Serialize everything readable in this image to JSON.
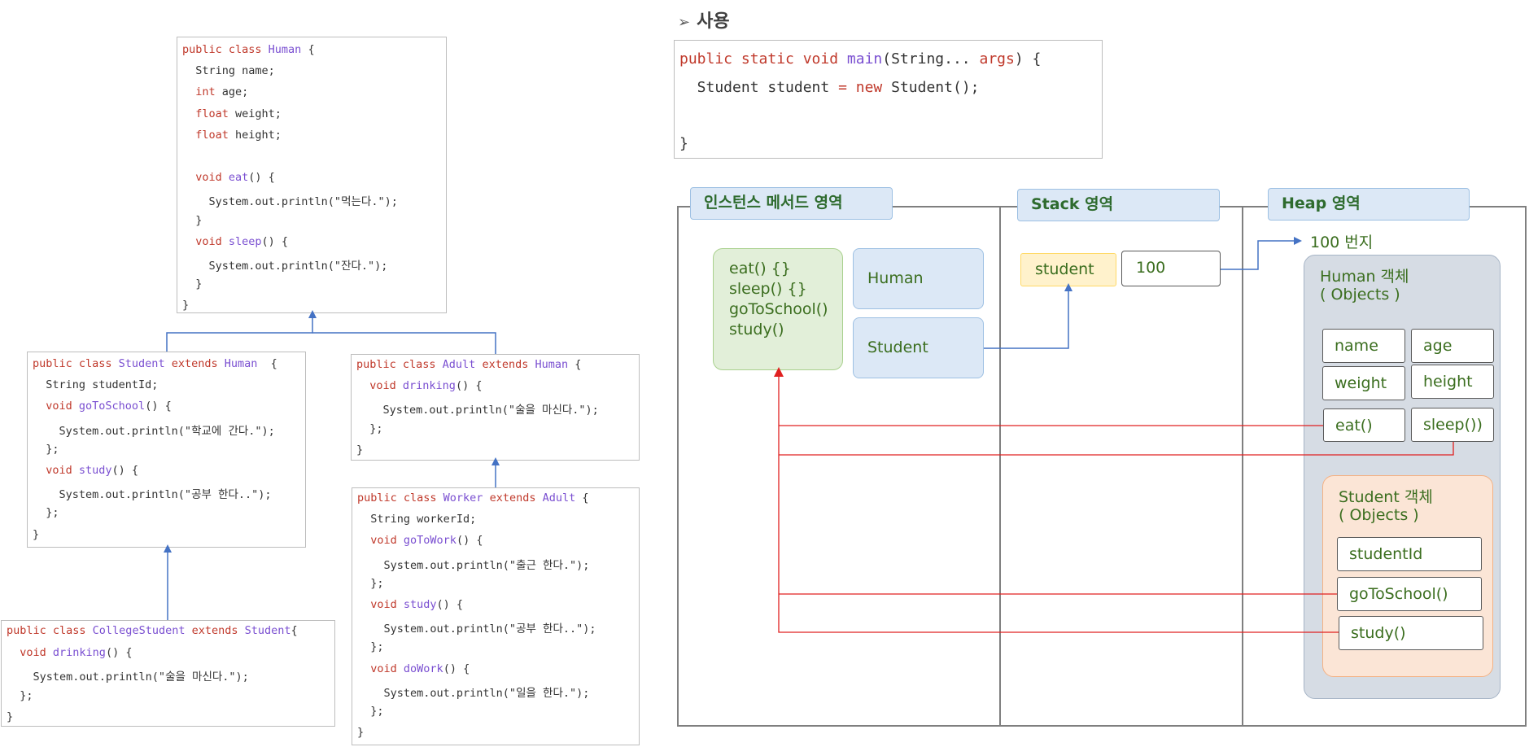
{
  "section_title": "사용",
  "classes": {
    "human": [
      [
        [
          "kw",
          "public class "
        ],
        [
          "tp",
          "Human"
        ],
        [
          "tx",
          " {"
        ]
      ],
      [
        [
          "tx",
          "  String name;"
        ]
      ],
      [
        [
          "kw",
          "  int"
        ],
        [
          "tx",
          " age;"
        ]
      ],
      [
        [
          "kw",
          "  float"
        ],
        [
          "tx",
          " weight;"
        ]
      ],
      [
        [
          "kw",
          "  float"
        ],
        [
          "tx",
          " height;"
        ]
      ],
      [
        [
          "tx",
          ""
        ]
      ],
      [
        [
          "kw",
          "  void "
        ],
        [
          "fn",
          "eat"
        ],
        [
          "tx",
          "() {"
        ]
      ],
      [
        [
          "tx",
          "    System.out.println(\"먹는다.\");"
        ]
      ],
      [
        [
          "tx",
          "  }"
        ]
      ],
      [
        [
          "kw",
          "  void "
        ],
        [
          "fn",
          "sleep"
        ],
        [
          "tx",
          "() {"
        ]
      ],
      [
        [
          "tx",
          "    System.out.println(\"잔다.\");"
        ]
      ],
      [
        [
          "tx",
          "  }"
        ]
      ],
      [
        [
          "tx",
          "}"
        ]
      ]
    ],
    "student": [
      [
        [
          "kw",
          "public class "
        ],
        [
          "tp",
          "Student"
        ],
        [
          "kw",
          " extends "
        ],
        [
          "tp",
          "Human"
        ],
        [
          "tx",
          "  {"
        ]
      ],
      [
        [
          "tx",
          "  String studentId;"
        ]
      ],
      [
        [
          "kw",
          "  void "
        ],
        [
          "fn",
          "goToSchool"
        ],
        [
          "tx",
          "() {"
        ]
      ],
      [
        [
          "tx",
          "    System.out.println(\"학교에 간다.\");"
        ]
      ],
      [
        [
          "tx",
          "  };"
        ]
      ],
      [
        [
          "kw",
          "  void "
        ],
        [
          "fn",
          "study"
        ],
        [
          "tx",
          "() {"
        ]
      ],
      [
        [
          "tx",
          "    System.out.println(\"공부 한다..\");"
        ]
      ],
      [
        [
          "tx",
          "  };"
        ]
      ],
      [
        [
          "tx",
          "}"
        ]
      ]
    ],
    "adult": [
      [
        [
          "kw",
          "public class "
        ],
        [
          "tp",
          "Adult"
        ],
        [
          "kw",
          " extends "
        ],
        [
          "tp",
          "Human"
        ],
        [
          "tx",
          " {"
        ]
      ],
      [
        [
          "kw",
          "  void "
        ],
        [
          "fn",
          "drinking"
        ],
        [
          "tx",
          "() {"
        ]
      ],
      [
        [
          "tx",
          "    System.out.println(\"술을 마신다.\");"
        ]
      ],
      [
        [
          "tx",
          "  };"
        ]
      ],
      [
        [
          "tx",
          "}"
        ]
      ]
    ],
    "college": [
      [
        [
          "kw",
          "public class "
        ],
        [
          "tp",
          "CollegeStudent"
        ],
        [
          "kw",
          " extends "
        ],
        [
          "tp",
          "Student"
        ],
        [
          "tx",
          "{"
        ]
      ],
      [
        [
          "kw",
          "  void "
        ],
        [
          "fn",
          "drinking"
        ],
        [
          "tx",
          "() {"
        ]
      ],
      [
        [
          "tx",
          "    System.out.println(\"술을 마신다.\");"
        ]
      ],
      [
        [
          "tx",
          "  };"
        ]
      ],
      [
        [
          "tx",
          "}"
        ]
      ]
    ],
    "worker": [
      [
        [
          "kw",
          "public class "
        ],
        [
          "tp",
          "Worker"
        ],
        [
          "kw",
          " extends "
        ],
        [
          "tp",
          "Adult"
        ],
        [
          "tx",
          " {"
        ]
      ],
      [
        [
          "tx",
          "  String workerId;"
        ]
      ],
      [
        [
          "kw",
          "  void "
        ],
        [
          "fn",
          "goToWork"
        ],
        [
          "tx",
          "() {"
        ]
      ],
      [
        [
          "tx",
          "    System.out.println(\"출근 한다.\");"
        ]
      ],
      [
        [
          "tx",
          "  };"
        ]
      ],
      [
        [
          "kw",
          "  void "
        ],
        [
          "fn",
          "study"
        ],
        [
          "tx",
          "() {"
        ]
      ],
      [
        [
          "tx",
          "    System.out.println(\"공부 한다..\");"
        ]
      ],
      [
        [
          "tx",
          "  };"
        ]
      ],
      [
        [
          "kw",
          "  void "
        ],
        [
          "fn",
          "doWork"
        ],
        [
          "tx",
          "() {"
        ]
      ],
      [
        [
          "tx",
          "    System.out.println(\"일을 한다.\");"
        ]
      ],
      [
        [
          "tx",
          "  };"
        ]
      ],
      [
        [
          "tx",
          "}"
        ]
      ]
    ],
    "main": [
      [
        [
          "kw",
          "public static void "
        ],
        [
          "fn",
          "main"
        ],
        [
          "tx",
          "(String... "
        ],
        [
          "kw",
          "args"
        ],
        [
          "tx",
          ") {"
        ]
      ],
      [
        [
          "tx",
          "  Student student "
        ],
        [
          "kw",
          "="
        ],
        [
          "kw",
          " new"
        ],
        [
          "tx",
          " Student();"
        ]
      ],
      [
        [
          "tx",
          ""
        ]
      ],
      [
        [
          "tx",
          "}"
        ]
      ]
    ]
  },
  "memory": {
    "method_area_title": "인스턴스 메서드 영역",
    "stack_title": "Stack 영역",
    "heap_title": "Heap 영역",
    "methods": [
      "eat() {}",
      "sleep() {}",
      "goToSchool()",
      "study()"
    ],
    "class_boxes": [
      "Human",
      "Student"
    ],
    "stack_var": "student",
    "stack_value": "100",
    "address_label": "100 번지",
    "human_object": {
      "title": "Human 객체",
      "subtitle": "( Objects )",
      "fields": [
        "name",
        "age",
        "weight",
        "height",
        "eat()",
        "sleep())"
      ]
    },
    "student_object": {
      "title": "Student 객체",
      "subtitle": "( Objects )",
      "fields": [
        "studentId",
        "goToSchool()",
        "study()"
      ]
    }
  },
  "colors": {
    "keyword": "#c0392b",
    "type": "#7a4fd1",
    "label_green": "#3b6e1f",
    "arrow_blue": "#4472c4",
    "arrow_red": "#e02020",
    "method_box": "#e2efd9",
    "class_box": "#dce8f6",
    "stack_var_box": "#fff2cc",
    "heap_box": "#d6dce4",
    "student_obj_box": "#fbe5d6"
  }
}
